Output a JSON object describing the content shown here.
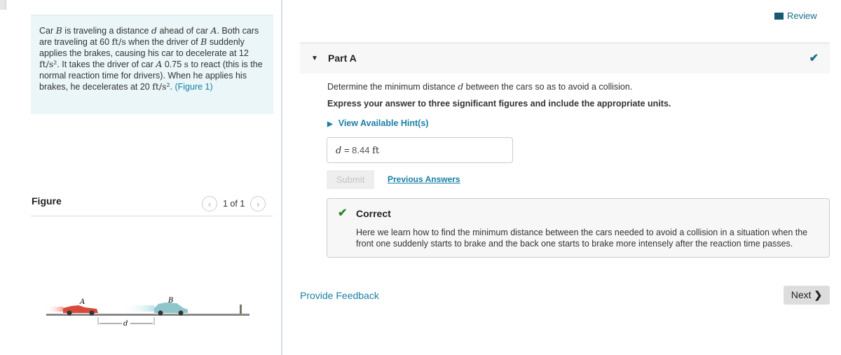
{
  "problem": {
    "t1": "Car ",
    "B": "B",
    "t2": " is traveling a distance ",
    "d": "d",
    "t3": " ahead of car ",
    "A": "A",
    "t4": ". Both cars are traveling at 60 ",
    "u1": "ft/s",
    "t5": " when the driver of ",
    "B2": "B",
    "t6": " suddenly applies the brakes, causing his car to decelerate at 12 ",
    "u2": "ft/s²",
    "t7": ". It takes the driver of car ",
    "A2": "A",
    "t8": " 0.75 ",
    "u3": "s",
    "t9": " to react (this is the normal reaction time for drivers). When he applies his brakes, he decelerates at 20 ",
    "u4": "ft/s²",
    "t10": ". ",
    "figure_link": "(Figure 1)"
  },
  "figure": {
    "title": "Figure",
    "count": "1 of 1",
    "label_a": "A",
    "label_b": "B",
    "label_d": "d"
  },
  "header": {
    "review": "Review"
  },
  "part": {
    "label": "Part A",
    "q1": "Determine the minimum distance ",
    "qvar": "d",
    "q2": " between the cars so as to avoid a collision.",
    "instructions": "Express your answer to three significant figures and include the appropriate units.",
    "hint": "View Available Hint(s)",
    "answer_var": "d",
    "answer_eq": " = ",
    "answer_value": "8.44",
    "answer_unit": "ft",
    "submit": "Submit",
    "previous": "Previous Answers"
  },
  "feedback": {
    "title": "Correct",
    "text": "Here we learn how to find the minimum distance between the cars needed to avoid a collision in a situation when the front one suddenly starts to brake and the back one starts to brake more intensely after the reaction time passes."
  },
  "footer": {
    "provide_feedback": "Provide Feedback",
    "next": "Next"
  },
  "colors": {
    "link": "#1a7fa6",
    "correct": "#2a8a2a",
    "problem_bg": "#eaf6f7"
  }
}
